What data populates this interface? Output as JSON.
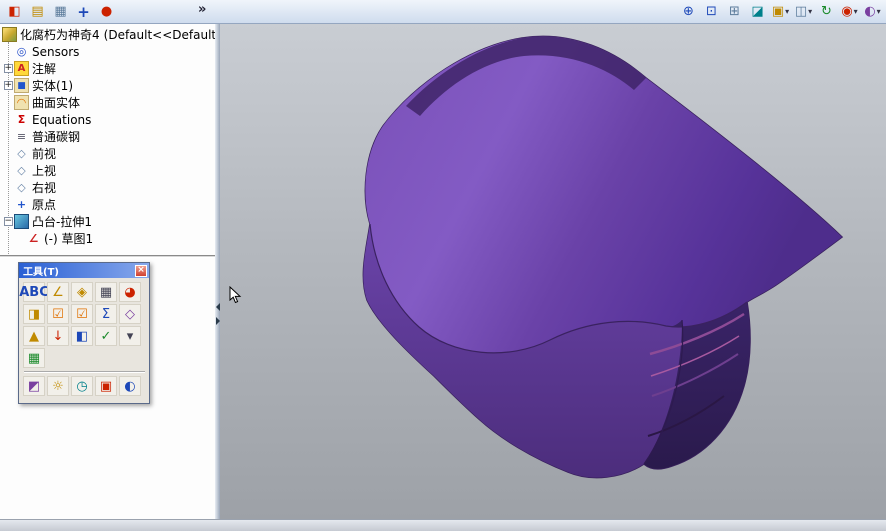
{
  "main_toolbar": {
    "chevron": "»",
    "left_icons": [
      {
        "name": "part-cube-icon",
        "glyph": "◧"
      },
      {
        "name": "page-edit-icon",
        "glyph": "▤"
      },
      {
        "name": "design-table-icon",
        "glyph": "▦"
      },
      {
        "name": "move-arrows-icon",
        "glyph": "+"
      },
      {
        "name": "sphere-icon",
        "glyph": "●"
      }
    ],
    "right_icons": [
      {
        "name": "zoom-in-icon",
        "glyph": "⊕"
      },
      {
        "name": "zoom-area-icon",
        "glyph": "⊡"
      },
      {
        "name": "zoom-fit-icon",
        "glyph": "⊞"
      },
      {
        "name": "section-view-icon",
        "glyph": "◪"
      },
      {
        "name": "view-orientation-icon",
        "glyph": "▣",
        "caret": "▾"
      },
      {
        "name": "display-style-icon",
        "glyph": "◫",
        "caret": "▾"
      },
      {
        "name": "rotate-view-icon",
        "glyph": "↻"
      },
      {
        "name": "appearances-icon",
        "glyph": "◉",
        "caret": "▾"
      },
      {
        "name": "scene-icon",
        "glyph": "◐",
        "caret": "▾"
      }
    ]
  },
  "feature_tree": {
    "root": {
      "label": "化腐朽为神奇4",
      "config": "(Default<<Default..."
    },
    "items": [
      {
        "label": "Sensors",
        "glyph": "◎"
      },
      {
        "label": "注解",
        "glyph": "A",
        "expand": "+"
      },
      {
        "label": "实体(1)",
        "glyph": "■",
        "expand": "+"
      },
      {
        "label": "曲面实体",
        "glyph": "◠"
      },
      {
        "label": "Equations",
        "glyph": "Σ"
      },
      {
        "label": "普通碳钢",
        "glyph": "≡"
      },
      {
        "label": "前视",
        "glyph": "◇"
      },
      {
        "label": "上视",
        "glyph": "◇"
      },
      {
        "label": "右视",
        "glyph": "◇"
      },
      {
        "label": "原点",
        "glyph": "+"
      },
      {
        "label": "凸台-拉伸1",
        "glyph": "",
        "expand": "−"
      },
      {
        "label": "(-) 草图1",
        "glyph": "∠"
      }
    ]
  },
  "tools_palette": {
    "title": "工具(T)",
    "close": "×",
    "rows": [
      [
        {
          "name": "spellcheck-icon",
          "glyph": "ABC"
        },
        {
          "name": "measure-icon",
          "glyph": "∠"
        },
        {
          "name": "mass-properties-icon",
          "glyph": "◈"
        },
        {
          "name": "section-properties-icon",
          "glyph": "▦"
        },
        {
          "name": "performance-pie-icon",
          "glyph": "◕"
        }
      ],
      [
        {
          "name": "design-check-icon",
          "glyph": "◨"
        },
        {
          "name": "checkbox-check-icon",
          "glyph": "☑"
        },
        {
          "name": "checkbox-verify-icon",
          "glyph": "☑"
        },
        {
          "name": "equations-sigma-icon",
          "glyph": "Σ"
        },
        {
          "name": "compare-geometry-icon",
          "glyph": "◇"
        }
      ],
      [
        {
          "name": "warning-triangle-icon",
          "glyph": "▲"
        },
        {
          "name": "import-diagnostics-icon",
          "glyph": "↓"
        },
        {
          "name": "compare-documents-icon",
          "glyph": "◧"
        },
        {
          "name": "check-entity-icon",
          "glyph": "✓"
        },
        {
          "name": "more-tools-arrow-icon",
          "glyph": "▾"
        }
      ],
      [
        {
          "name": "design-table-grid-icon",
          "glyph": "▦"
        }
      ],
      [
        {
          "name": "appearance-brush-icon",
          "glyph": "◩"
        },
        {
          "name": "options-sun-icon",
          "glyph": "☼"
        },
        {
          "name": "schedule-clock-icon",
          "glyph": "◷"
        },
        {
          "name": "compare-blocks-icon",
          "glyph": "▣"
        },
        {
          "name": "globe-icon",
          "glyph": "◐"
        }
      ]
    ]
  },
  "colors": {
    "model_top": "#7a50b8",
    "model_front": "#5c3596",
    "model_side": "#33205c",
    "viewport_bg": "#b4b8be",
    "accent_title": "#2a60d4"
  }
}
